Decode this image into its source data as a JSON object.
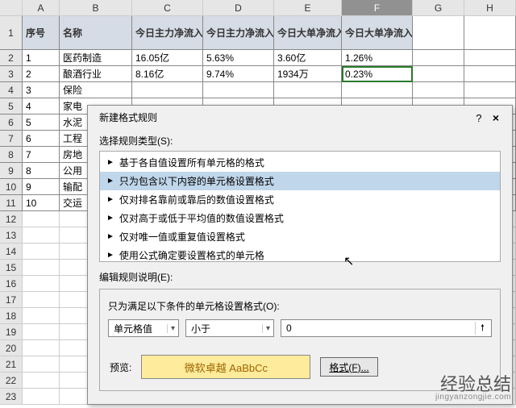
{
  "columns": [
    "A",
    "B",
    "C",
    "D",
    "E",
    "F",
    "G",
    "H"
  ],
  "table": {
    "headers": {
      "A": "序号",
      "B": "名称",
      "C": "今日主力净流入 净额",
      "D": "今日主力净流入 净占比",
      "E": "今日大单净流入 净额",
      "F": "今日大单净流入 净占比"
    },
    "rows": [
      {
        "n": "2",
        "A": "1",
        "B": "医药制造",
        "C": "16.05亿",
        "D": "5.63%",
        "E": "3.60亿",
        "F": "1.26%"
      },
      {
        "n": "3",
        "A": "2",
        "B": "酿酒行业",
        "C": "8.16亿",
        "D": "9.74%",
        "E": "1934万",
        "F": "0.23%"
      },
      {
        "n": "4",
        "A": "3",
        "B": "保险"
      },
      {
        "n": "5",
        "A": "4",
        "B": "家电"
      },
      {
        "n": "6",
        "A": "5",
        "B": "水泥"
      },
      {
        "n": "7",
        "A": "6",
        "B": "工程"
      },
      {
        "n": "8",
        "A": "7",
        "B": "房地"
      },
      {
        "n": "9",
        "A": "8",
        "B": "公用"
      },
      {
        "n": "10",
        "A": "9",
        "B": "输配"
      },
      {
        "n": "11",
        "A": "10",
        "B": "交运"
      }
    ],
    "empty_rows": [
      "12",
      "13",
      "14",
      "15",
      "16",
      "17",
      "18",
      "19",
      "20",
      "21",
      "22",
      "23"
    ]
  },
  "dialog": {
    "title": "新建格式规则",
    "help": "?",
    "close": "×",
    "select_label": "选择规则类型(S):",
    "rules": [
      "基于各自值设置所有单元格的格式",
      "只为包含以下内容的单元格设置格式",
      "仅对排名靠前或靠后的数值设置格式",
      "仅对高于或低于平均值的数值设置格式",
      "仅对唯一值或重复值设置格式",
      "使用公式确定要设置格式的单元格"
    ],
    "selected_rule_index": 1,
    "edit_label": "编辑规则说明(E):",
    "cond_label": "只为满足以下条件的单元格设置格式(O):",
    "combo1": "单元格值",
    "combo2": "小于",
    "textbox": "0",
    "preview_label": "预览:",
    "preview_text": "微软卓越 AaBbCc",
    "format_button": "格式(F)..."
  },
  "watermark": {
    "main": "经验总结",
    "sub": "jingyanzongjie.com"
  }
}
